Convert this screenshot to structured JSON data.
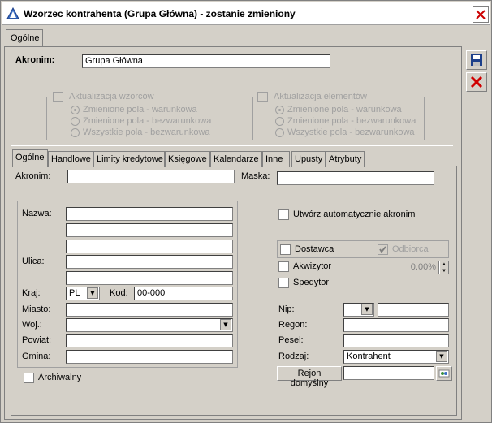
{
  "window": {
    "title": "Wzorzec kontrahenta (Grupa Główna) - zostanie zmieniony"
  },
  "outer_tab": "Ogólne",
  "akronim": {
    "label": "Akronim:",
    "value": "Grupa Główna"
  },
  "group_wzorcow": {
    "title": "Aktualizacja wzorców",
    "options": [
      "Zmienione pola - warunkowa",
      "Zmienione pola - bezwarunkowa",
      "Wszystkie pola - bezwarunkowa"
    ]
  },
  "group_elementow": {
    "title": "Aktualizacja elementów",
    "options": [
      "Zmienione pola - warunkowa",
      "Zmienione pola - bezwarunkowa",
      "Wszystkie pola - bezwarunkowa"
    ]
  },
  "tabs": [
    "Ogólne",
    "Handlowe",
    "Limity kredytowe",
    "Księgowe",
    "Kalendarze",
    "Inne",
    "Upusty",
    "Atrybuty"
  ],
  "form": {
    "akronim_label": "Akronim:",
    "akronim_value": "",
    "maska_label": "Maska:",
    "maska_value": "",
    "nazwa_label": "Nazwa:",
    "ulica_label": "Ulica:",
    "kraj_label": "Kraj:",
    "kraj_value": "PL",
    "kod_label": "Kod:",
    "kod_value": "00-000",
    "miasto_label": "Miasto:",
    "woj_label": "Woj.:",
    "powiat_label": "Powiat:",
    "gmina_label": "Gmina:",
    "archiwalny_label": "Archiwalny",
    "utworz_label": "Utwórz automatycznie akronim",
    "dostawca_label": "Dostawca",
    "odbiorca_label": "Odbiorca",
    "akwizytor_label": "Akwizytor",
    "akwizytor_value": "0.00%",
    "spedytor_label": "Spedytor",
    "nip_label": "Nip:",
    "regon_label": "Regon:",
    "pesel_label": "Pesel:",
    "rodzaj_label": "Rodzaj:",
    "rodzaj_value": "Kontrahent",
    "rejon_button": "Rejon domyślny"
  },
  "icons": {
    "save": "save-icon",
    "cancel": "cancel-icon",
    "close": "close-icon"
  }
}
